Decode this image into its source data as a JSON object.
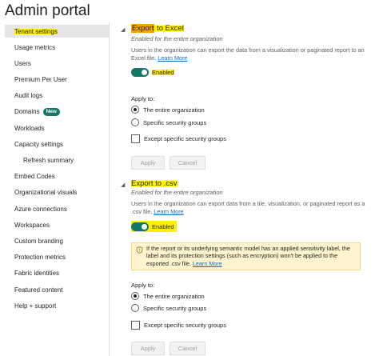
{
  "page": {
    "title": "Admin portal"
  },
  "sidebar": {
    "items": [
      {
        "label": "Tenant settings"
      },
      {
        "label": "Usage metrics"
      },
      {
        "label": "Users"
      },
      {
        "label": "Premium Per User"
      },
      {
        "label": "Audit logs"
      },
      {
        "label": "Domains",
        "badge": "New"
      },
      {
        "label": "Workloads"
      },
      {
        "label": "Capacity settings"
      },
      {
        "label": "Refresh summary"
      },
      {
        "label": "Embed Codes"
      },
      {
        "label": "Organizational visuals"
      },
      {
        "label": "Azure connections"
      },
      {
        "label": "Workspaces"
      },
      {
        "label": "Custom branding"
      },
      {
        "label": "Protection metrics"
      },
      {
        "label": "Fabric identities"
      },
      {
        "label": "Featured content"
      },
      {
        "label": "Help + support"
      }
    ]
  },
  "excel": {
    "title_word": "Export",
    "title_rest": " to Excel",
    "subtitle": "Enabled for the entire organization",
    "description": "Users in the organization can export the data from a visualization or paginated report to an Excel file.",
    "learn_more": "Learn More",
    "toggle_label": "Enabled",
    "apply_to": "Apply to:",
    "option_entire": "The entire organization",
    "option_groups": "Specific security groups",
    "except_label": "Except specific security groups",
    "apply_button": "Apply",
    "cancel_button": "Cancel"
  },
  "csv": {
    "title": "Export to .csv",
    "subtitle": "Enabled for the entire organization",
    "description": "Users in the organization can export data from a tile, visualization, or paginated report as a .csv file.",
    "learn_more": "Learn More",
    "toggle_label": "Enabled",
    "warning_text": "If the report or its underlying semantic model has an applied sensitivity label, the label and its protection settings (such as encryption) won't be applied to the exported .csv file.",
    "warning_link": "Learn More",
    "apply_to": "Apply to:",
    "option_entire": "The entire organization",
    "option_groups": "Specific security groups",
    "except_label": "Except specific security groups",
    "apply_button": "Apply",
    "cancel_button": "Cancel"
  },
  "colors": {
    "accent_green": "#117865",
    "highlight_yellow": "#fff000",
    "highlight_orange": "#f4a300",
    "warning_bg": "#fff4ce",
    "link_blue": "#0f6cbd"
  },
  "icons": {
    "section_caret": "caret-down-icon",
    "warning": "shield-warning-icon"
  }
}
